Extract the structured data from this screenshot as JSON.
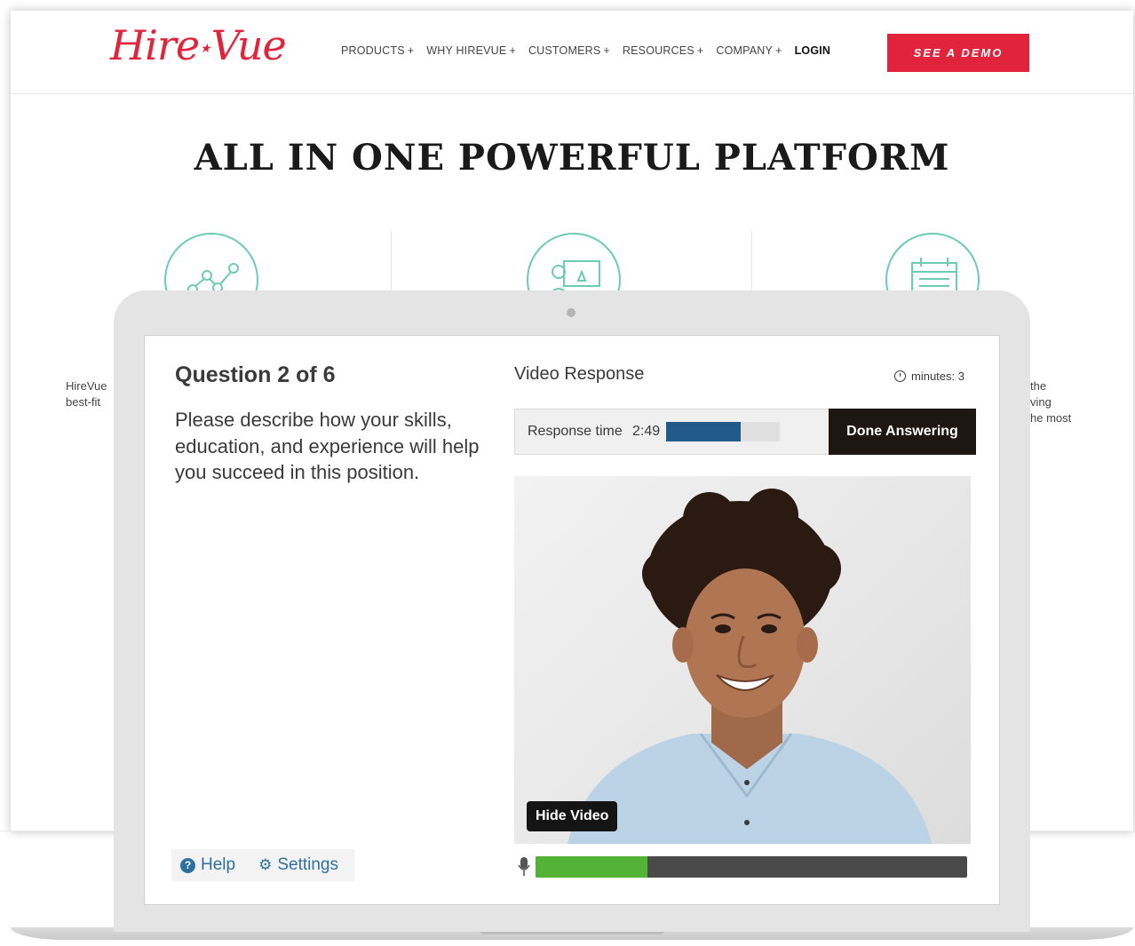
{
  "site": {
    "logo": {
      "left": "Hire",
      "star": "★",
      "right": "Vue"
    },
    "nav": [
      {
        "label": "PRODUCTS"
      },
      {
        "label": "WHY HIREVUE"
      },
      {
        "label": "CUSTOMERS"
      },
      {
        "label": "RESOURCES"
      },
      {
        "label": "COMPANY"
      }
    ],
    "nav_plus": "+",
    "login_label": "LOGIN",
    "demo_label": "SEE A DEMO",
    "title": "ALL IN ONE POWERFUL PLATFORM",
    "feature_icons": [
      "analytics-chart-icon",
      "presenter-icon",
      "calendar-icon"
    ],
    "peek_left": [
      "HireVue",
      "best-fit"
    ],
    "peek_right": [
      "the",
      "ving",
      "he most"
    ],
    "accent_color": "#e1243b",
    "icon_color": "#6ccbb3"
  },
  "interview": {
    "question_title": "Question 2 of 6",
    "question_text": "Please describe how your skills, education, and experience will help you succeed in this position.",
    "video_title": "Video Response",
    "minutes_label": "minutes: 3",
    "response_label": "Response time",
    "response_time": "2:49",
    "response_progress": 0.66,
    "done_label": "Done Answering",
    "hide_video_label": "Hide Video",
    "audio_level": 0.26,
    "help_label": "Help",
    "settings_label": "Settings",
    "progress_color": "#235a8c",
    "audio_color": "#52b337"
  }
}
